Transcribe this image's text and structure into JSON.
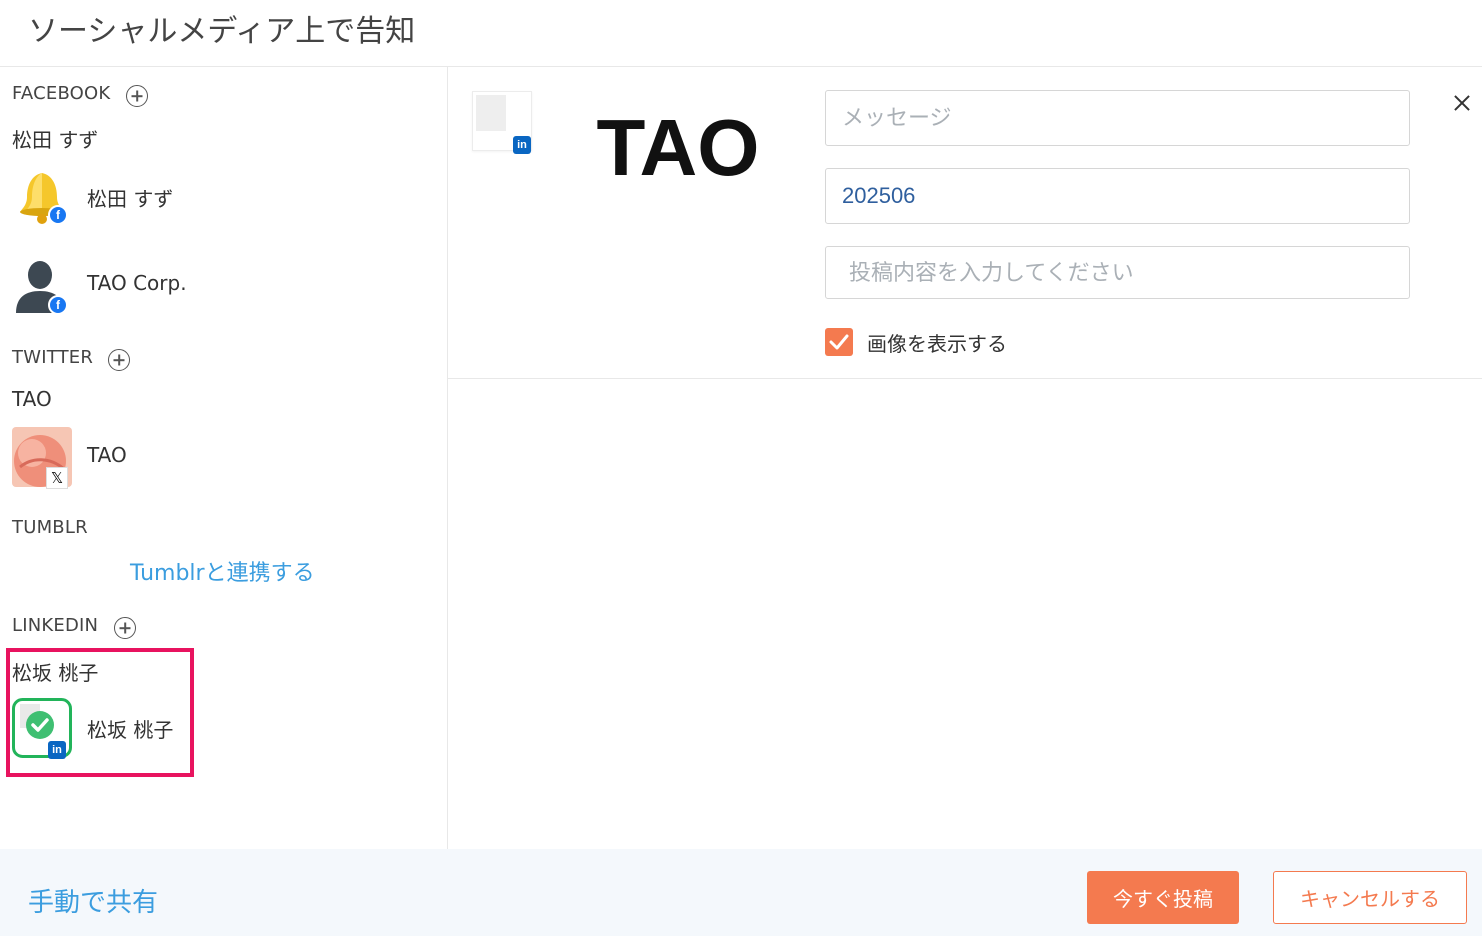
{
  "header": {
    "title": "ソーシャルメディア上で告知"
  },
  "sidebar": {
    "facebook": {
      "label": "FACEBOOK",
      "group_name": "松田 すず",
      "accounts": [
        {
          "name": "松田 すず",
          "avatar": "bell-icon",
          "network_badge": "facebook-icon"
        },
        {
          "name": "TAO Corp.",
          "avatar": "person-silhouette-icon",
          "network_badge": "facebook-icon"
        }
      ]
    },
    "twitter": {
      "label": "TWITTER",
      "group_name": "TAO",
      "accounts": [
        {
          "name": "TAO",
          "avatar": "peach-photo",
          "network_badge": "x-icon"
        }
      ]
    },
    "tumblr": {
      "label": "TUMBLR",
      "connect_link": "Tumblrと連携する"
    },
    "linkedin": {
      "label": "LINKEDIN",
      "group_name": "松坂 桃子",
      "accounts": [
        {
          "name": "松坂 桃子",
          "avatar": "selected-check-icon",
          "network_badge": "linkedin-icon",
          "selected": true
        }
      ]
    }
  },
  "post_panel": {
    "thumbnail_badge": "in",
    "logo_text": "TAO",
    "message_placeholder": "メッセージ",
    "title_value": "202506",
    "body_placeholder": "投稿内容を入力してください",
    "show_image_label": "画像を表示する",
    "show_image_checked": true
  },
  "footer": {
    "manual_share": "手動で共有",
    "post_now": "今すぐ投稿",
    "cancel": "キャンセルする"
  },
  "colors": {
    "accent_orange": "#f47a4f",
    "link_blue": "#3b9ddf",
    "highlight_pink": "#e8135f",
    "selected_green": "#22b45a",
    "facebook_blue": "#1877f2",
    "linkedin_blue": "#0a66c2"
  }
}
